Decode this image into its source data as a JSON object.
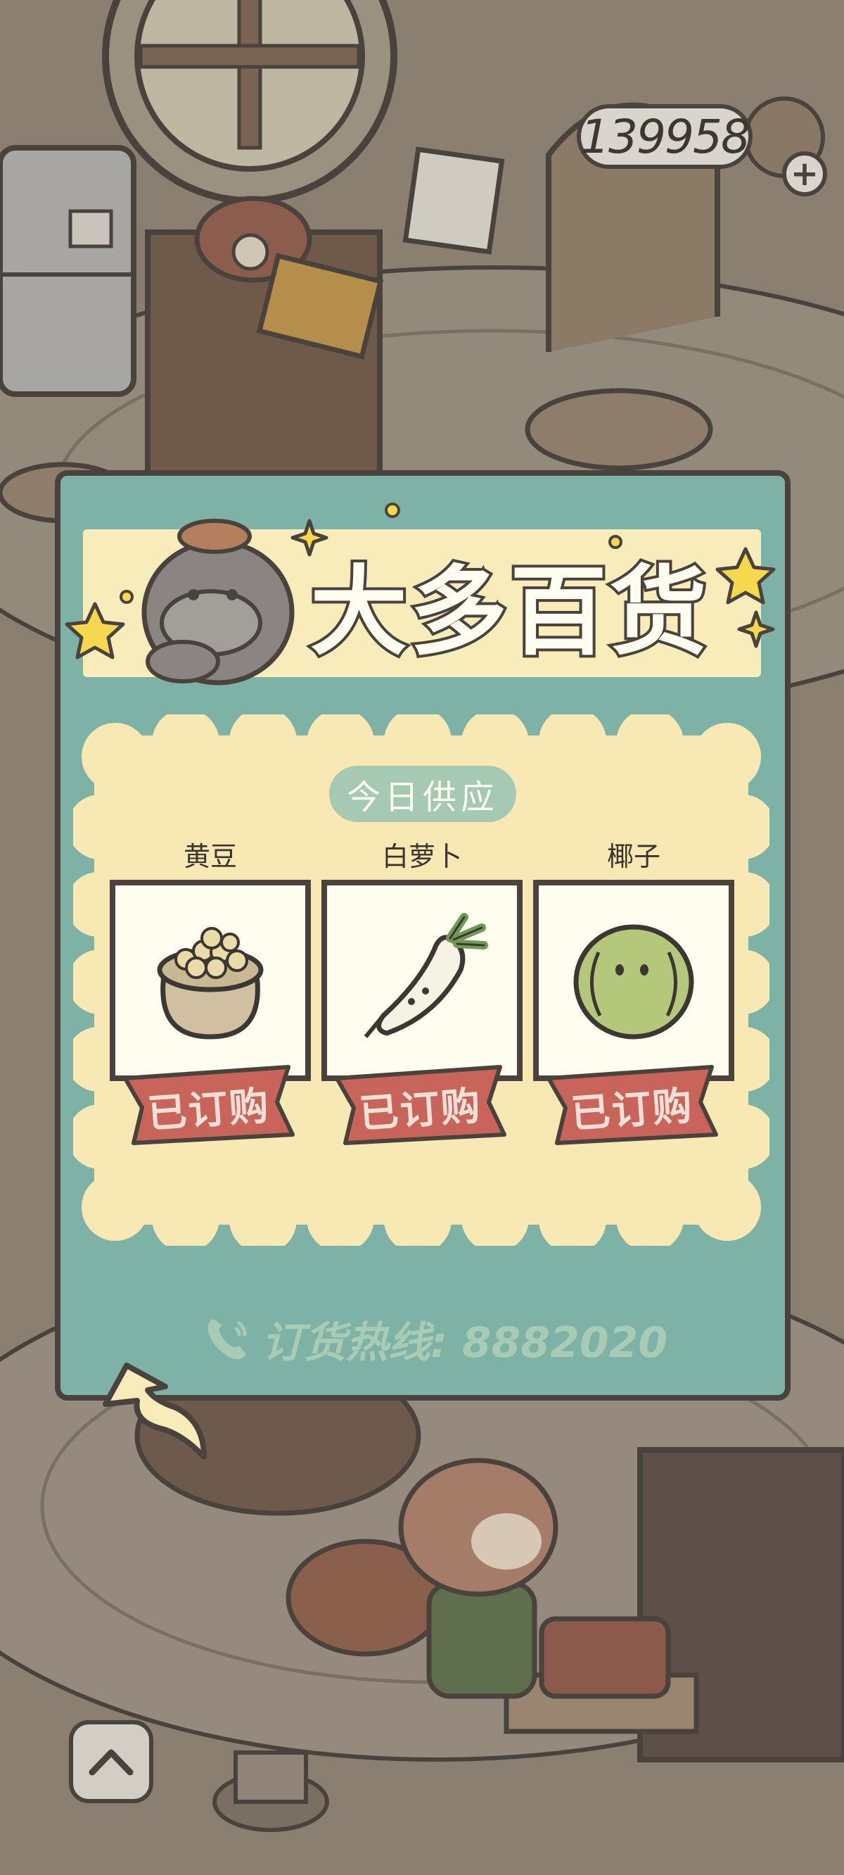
{
  "hud": {
    "coins": "139958",
    "plus_icon": "plus-icon"
  },
  "shop": {
    "title": "大多百货",
    "today_label": "今日供应",
    "items": [
      {
        "name": "黄豆",
        "icon": "soybean-sack-icon",
        "status": "已订购"
      },
      {
        "name": "白萝卜",
        "icon": "white-radish-icon",
        "status": "已订购"
      },
      {
        "name": "椰子",
        "icon": "coconut-icon",
        "status": "已订购"
      }
    ],
    "hotline": "订货热线: 8882020"
  },
  "colors": {
    "panel": "#7fb2a6",
    "banner": "#f8ecbb",
    "cream": "#f8e9b4",
    "tag": "#c8645a",
    "outline": "#4a423c"
  }
}
